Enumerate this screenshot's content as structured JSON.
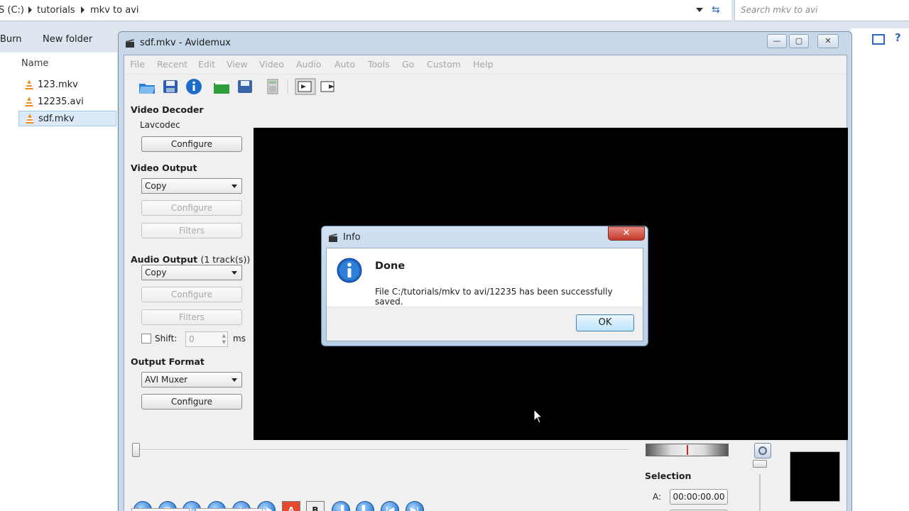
{
  "explorer": {
    "address": {
      "drive": "S (C:)",
      "folder1": "tutorials",
      "folder2": "mkv to avi"
    },
    "search_placeholder": "Search mkv to avi",
    "commands": {
      "burn": "Burn",
      "new_folder": "New folder"
    },
    "column_name": "Name",
    "files": [
      {
        "name": "123.mkv"
      },
      {
        "name": "12235.avi"
      },
      {
        "name": "sdf.mkv",
        "selected": true
      }
    ]
  },
  "window": {
    "title": "sdf.mkv - Avidemux",
    "menu": [
      "File",
      "Recent",
      "Edit",
      "View",
      "Video",
      "Audio",
      "Auto",
      "Tools",
      "Go",
      "Custom",
      "Help"
    ]
  },
  "panel": {
    "video_decoder": {
      "title": "Video Decoder",
      "value": "Lavcodec",
      "configure": "Configure"
    },
    "video_output": {
      "title": "Video Output",
      "codec": "Copy",
      "configure": "Configure",
      "filters": "Filters"
    },
    "audio_output": {
      "title": "Audio Output",
      "tracks": "(1 track(s))",
      "codec": "Copy",
      "configure": "Configure",
      "filters": "Filters",
      "shift_label": "Shift:",
      "shift_value": "0",
      "shift_unit": "ms"
    },
    "output_format": {
      "title": "Output Format",
      "muxer": "AVI Muxer",
      "configure": "Configure"
    }
  },
  "dialog": {
    "title": "Info",
    "heading": "Done",
    "message": "File C:/tutorials/mkv to avi/12235 has been successfully saved.",
    "ok": "OK"
  },
  "bottom": {
    "selection_label": "Selection",
    "a_label": "A:",
    "a_time": "00:00:00.00"
  },
  "colors": {
    "accent": "#2f7fd6",
    "video_bg": "#000000",
    "close_red": "#c1392b"
  }
}
